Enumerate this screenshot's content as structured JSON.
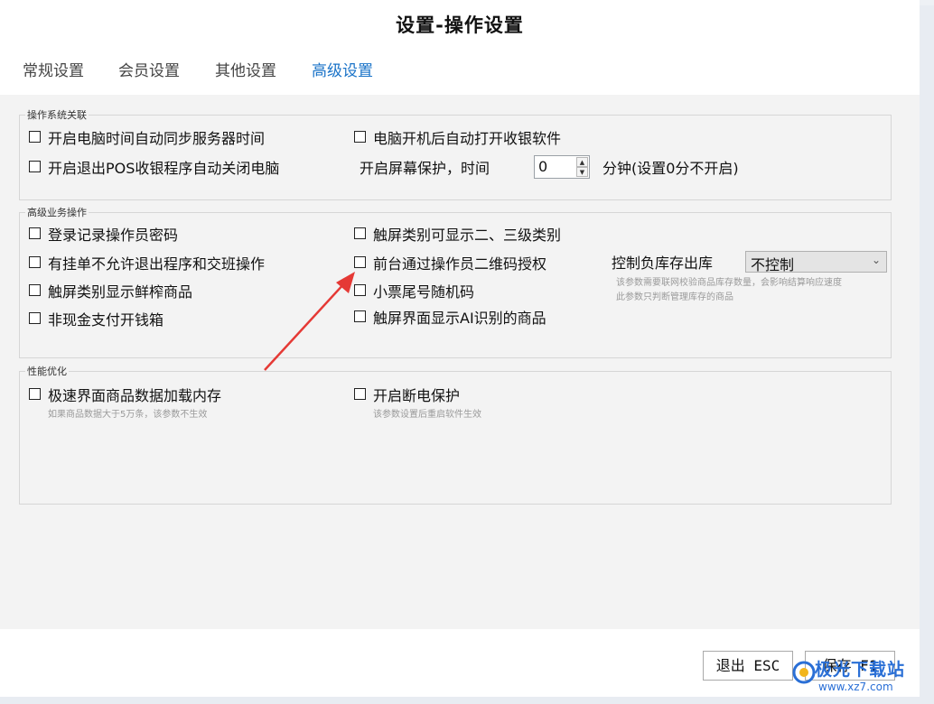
{
  "window": {
    "title": "设置-操作设置"
  },
  "tabs": [
    {
      "label": "常规设置",
      "active": false
    },
    {
      "label": "会员设置",
      "active": false
    },
    {
      "label": "其他设置",
      "active": false
    },
    {
      "label": "高级设置",
      "active": true
    }
  ],
  "groups": {
    "system": {
      "legend": "操作系统关联",
      "auto_sync_time": "开启电脑时间自动同步服务器时间",
      "auto_open_pos": "电脑开机后自动打开收银软件",
      "shutdown_on_exit": "开启退出POS收银程序自动关闭电脑",
      "screensaver_label": "开启屏幕保护，时间",
      "screensaver_value": "0",
      "screensaver_suffix": "分钟(设置0分不开启)"
    },
    "business": {
      "legend": "高级业务操作",
      "record_password": "登录记录操作员密码",
      "pending_no_exit": "有挂单不允许退出程序和交班操作",
      "touch_fresh": "触屏类别显示鲜榨商品",
      "noncash_drawer": "非现金支付开钱箱",
      "touch_subcategory": "触屏类别可显示二、三级类别",
      "qr_authorize": "前台通过操作员二维码授权",
      "receipt_random": "小票尾号随机码",
      "touch_ai": "触屏界面显示AI识别的商品",
      "negative_stock_label": "控制负库存出库",
      "negative_stock_value": "不控制",
      "negative_stock_hint_1": "该参数需要联网校验商品库存数量，会影响结算响应速度",
      "negative_stock_hint_2": "此参数只判断管理库存的商品"
    },
    "performance": {
      "legend": "性能优化",
      "cache_goods": "极速界面商品数据加载内存",
      "cache_hint": "如果商品数据大于5万条，该参数不生效",
      "power_protect": "开启断电保护",
      "power_hint": "该参数设置后重启软件生效"
    }
  },
  "footer": {
    "exit_label": "退出 ESC",
    "save_label": "保存 F1"
  },
  "watermark": {
    "text": "极光下载站",
    "url": "www.xz7.com"
  },
  "colors": {
    "active_tab": "#1a73c8",
    "arrow": "#e53935"
  }
}
